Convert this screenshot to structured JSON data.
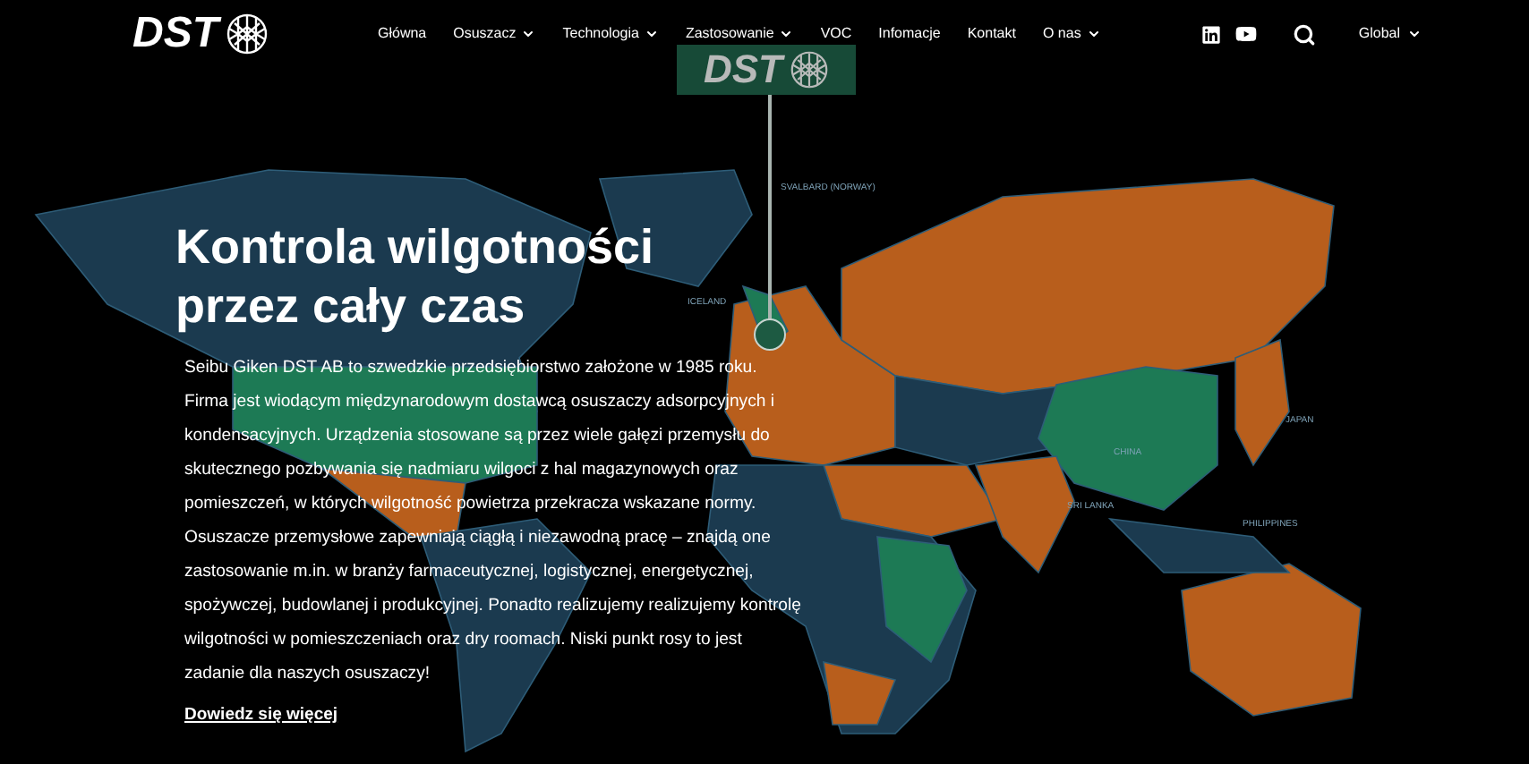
{
  "header": {
    "logo": "DST",
    "nav": [
      {
        "label": "Główna",
        "dropdown": false
      },
      {
        "label": "Osuszacz",
        "dropdown": true
      },
      {
        "label": "Technologia",
        "dropdown": true
      },
      {
        "label": "Zastosowanie",
        "dropdown": true
      },
      {
        "label": "VOC",
        "dropdown": false
      },
      {
        "label": "Infomacje",
        "dropdown": false
      },
      {
        "label": "Kontakt",
        "dropdown": false
      },
      {
        "label": "O nas",
        "dropdown": true
      }
    ],
    "region": "Global"
  },
  "map": {
    "pin_logo": "DST",
    "labels": [
      "SVALBARD (NORWAY)",
      "ICELAND",
      "JAPAN",
      "CHINA",
      "SRI LANKA",
      "PHILIPPINES"
    ]
  },
  "hero": {
    "title": "Kontrola wilgotności przez cały czas",
    "body": "Seibu Giken DST AB to szwedzkie przedsiębiorstwo założone w 1985 roku. Firma jest wiodącym międzynarodowym dostawcą osuszaczy adsorpcyjnych i kondensacyjnych. Urządzenia stosowane są przez wiele gałęzi przemysłu do skutecznego pozbywania się nadmiaru wilgoci z hal magazynowych oraz pomieszczeń, w których wilgotność powietrza przekracza wskazane normy. Osuszacze przemysłowe zapewniają ciągłą i niezawodną pracę – znajdą one zastosowanie m.in. w branży farmaceutycznej, logistycznej, energetycznej, spożywczej, budowlanej i produkcyjnej. Ponadto realizujemy realizujemy kontrolę wilgotności w pomieszczeniach oraz dry roomach. Niski punkt rosy to jest zadanie dla naszych osuszaczy!",
    "link": "Dowiedz się więcej"
  }
}
